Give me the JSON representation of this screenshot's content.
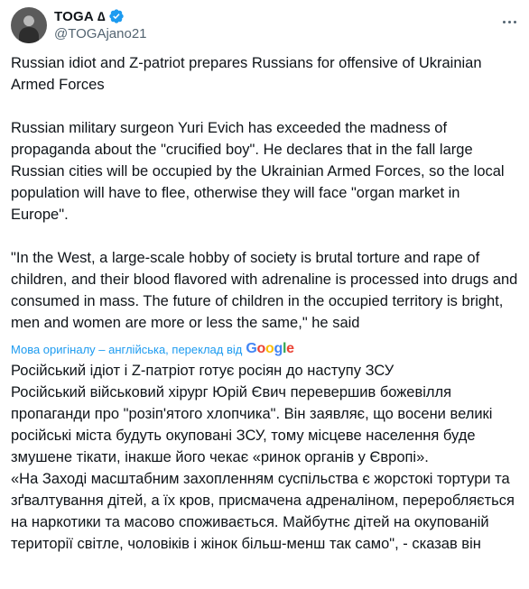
{
  "header": {
    "display_name": "TOGA",
    "name_symbol": "∆",
    "handle": "@TOGAjano21"
  },
  "tweet": {
    "title_en": "Russian idiot and Z-patriot prepares Russians for offensive of Ukrainian Armed Forces",
    "para1_en": "Russian military surgeon Yuri Evich has exceeded the madness of propaganda about the \"crucified boy\". He declares that in the fall large Russian cities will be occupied by the Ukrainian Armed Forces, so the local population will have to flee, otherwise they will face \"organ market in Europe\".",
    "para2_en": "\"In the West, a large-scale hobby of society is brutal torture and rape of children, and their blood flavored with adrenaline is processed into drugs and consumed in mass. The future of children in the occupied territory is bright, men and women are more or less the same,\" he said"
  },
  "translation": {
    "label": "Мова оригіналу – англійська, переклад від",
    "google_letters": [
      "G",
      "o",
      "o",
      "g",
      "l",
      "e"
    ],
    "title_uk": "Російський ідіот і Z-патріот готує росіян до наступу ЗСУ",
    "para1_uk": "Російський військовий хірург Юрій Євич перевершив божевілля пропаганди про \"розіп'ятого хлопчика\". Він заявляє, що восени великі російські міста будуть окуповані ЗСУ, тому місцеве населення буде змушене тікати, інакше його чекає «ринок органів у Європі».",
    "para2_uk": "«На Заході масштабним захопленням суспільства є жорстокі тортури та зґвалтування дітей, а їх кров, присмачена адреналіном, переробляється на наркотики та масово споживається. Майбутнє дітей на окупованій території світле, чоловіків і жінок більш-менш так само\", - сказав він"
  },
  "colors": {
    "text": "#0f1419",
    "secondary": "#536471",
    "link": "#1d9bf0",
    "verified": "#1d9bf0"
  },
  "icons": [
    "avatar",
    "verified-badge-icon",
    "more-options-icon",
    "google-logo"
  ]
}
